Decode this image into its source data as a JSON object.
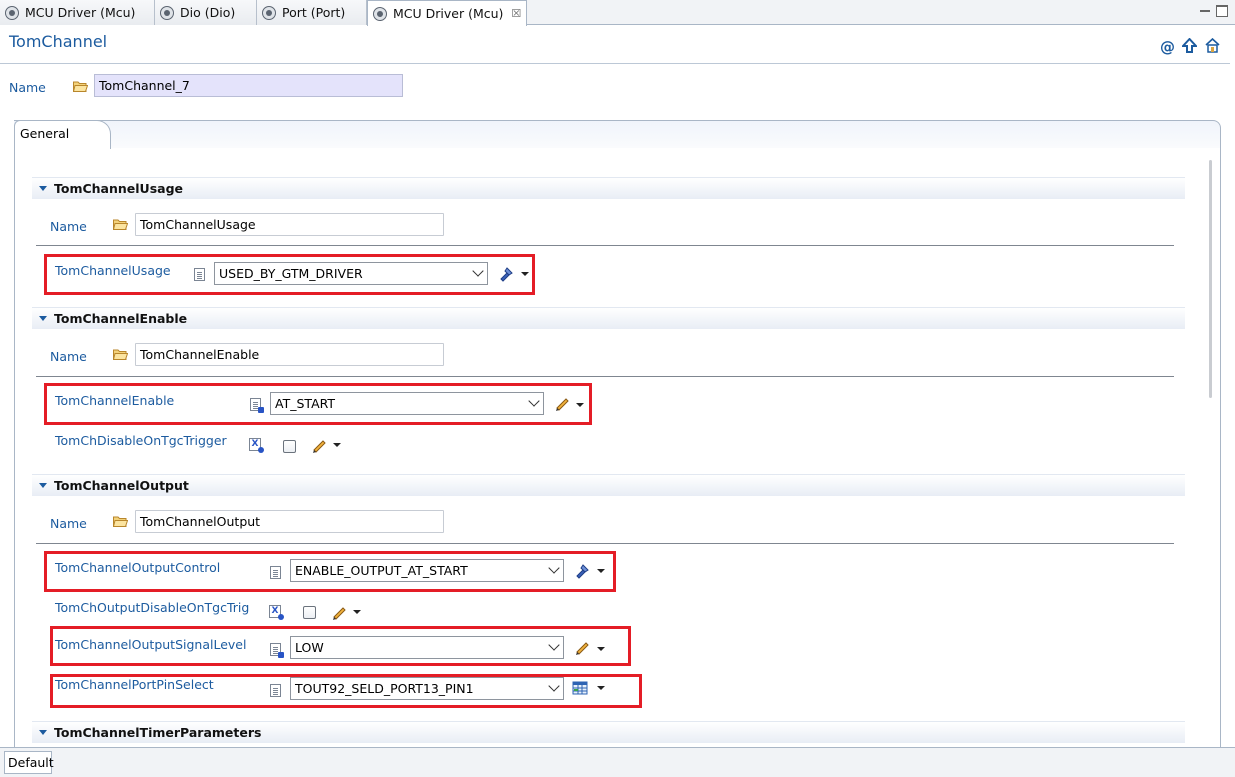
{
  "editor_tabs": [
    {
      "label": "MCU Driver (Mcu)"
    },
    {
      "label": "Dio (Dio)"
    },
    {
      "label": "Port (Port)"
    },
    {
      "label": "MCU Driver (Mcu)",
      "active": true,
      "close": "☒"
    }
  ],
  "page": {
    "title": "TomChannel",
    "name_label": "Name",
    "name_value": "TomChannel_7",
    "header_icons": [
      "at-icon",
      "arrow-up-icon",
      "home-icon"
    ]
  },
  "general_tab": {
    "label": "General"
  },
  "sections": {
    "usage": {
      "title": "TomChannelUsage",
      "name_label": "Name",
      "name_value": "TomChannelUsage",
      "param_label": "TomChannelUsage",
      "param_value": "USED_BY_GTM_DRIVER"
    },
    "enable": {
      "title": "TomChannelEnable",
      "name_label": "Name",
      "name_value": "TomChannelEnable",
      "param_label": "TomChannelEnable",
      "param_value": "AT_START",
      "disable_label": "TomChDisableOnTgcTrigger",
      "disable_checked": false
    },
    "output": {
      "title": "TomChannelOutput",
      "name_label": "Name",
      "name_value": "TomChannelOutput",
      "control_label": "TomChannelOutputControl",
      "control_value": "ENABLE_OUTPUT_AT_START",
      "disable_label": "TomChOutputDisableOnTgcTrig",
      "disable_checked": false,
      "signal_label": "TomChannelOutputSignalLevel",
      "signal_value": "LOW",
      "portpin_label": "TomChannelPortPinSelect",
      "portpin_value": "TOUT92_SELD_PORT13_PIN1"
    },
    "timer": {
      "title": "TomChannelTimerParameters"
    }
  },
  "bottom_tab": {
    "label": "Default"
  },
  "colors": {
    "accent": "#1c5b9f",
    "highlight": "#e41d26",
    "name_field_bg": "#e4e3fb"
  }
}
